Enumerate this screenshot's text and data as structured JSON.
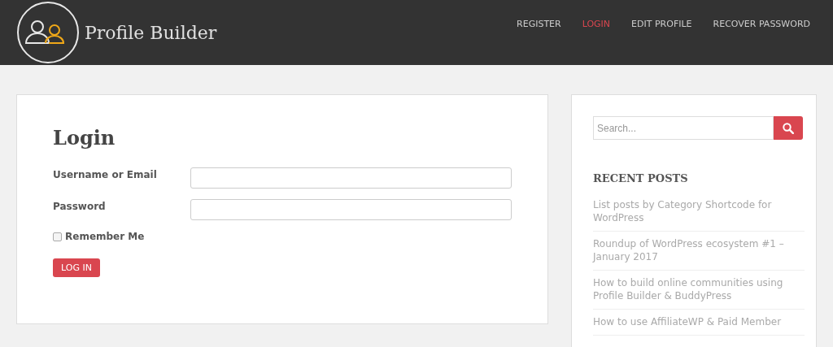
{
  "header": {
    "site_title": "Profile Builder",
    "nav": [
      {
        "label": "REGISTER",
        "selected": false
      },
      {
        "label": "LOGIN",
        "selected": true
      },
      {
        "label": "EDIT PROFILE",
        "selected": false
      },
      {
        "label": "RECOVER PASSWORD",
        "selected": false
      }
    ]
  },
  "login": {
    "title": "Login",
    "fields": [
      {
        "label": "Username or Email"
      },
      {
        "label": "Password"
      }
    ],
    "remember": {
      "label": "Remember Me",
      "checked": false
    },
    "button": "LOG IN"
  },
  "sidebar": {
    "search": {
      "placeholder": "Search..."
    },
    "recent_title": "RECENT POSTS",
    "posts": [
      "List posts by Category Shortcode for WordPress",
      "Roundup of WordPress ecosystem #1 – January 2017",
      "How to build online communities using Profile Builder & BuddyPress",
      "How to use AffiliateWP & Paid Member"
    ]
  }
}
